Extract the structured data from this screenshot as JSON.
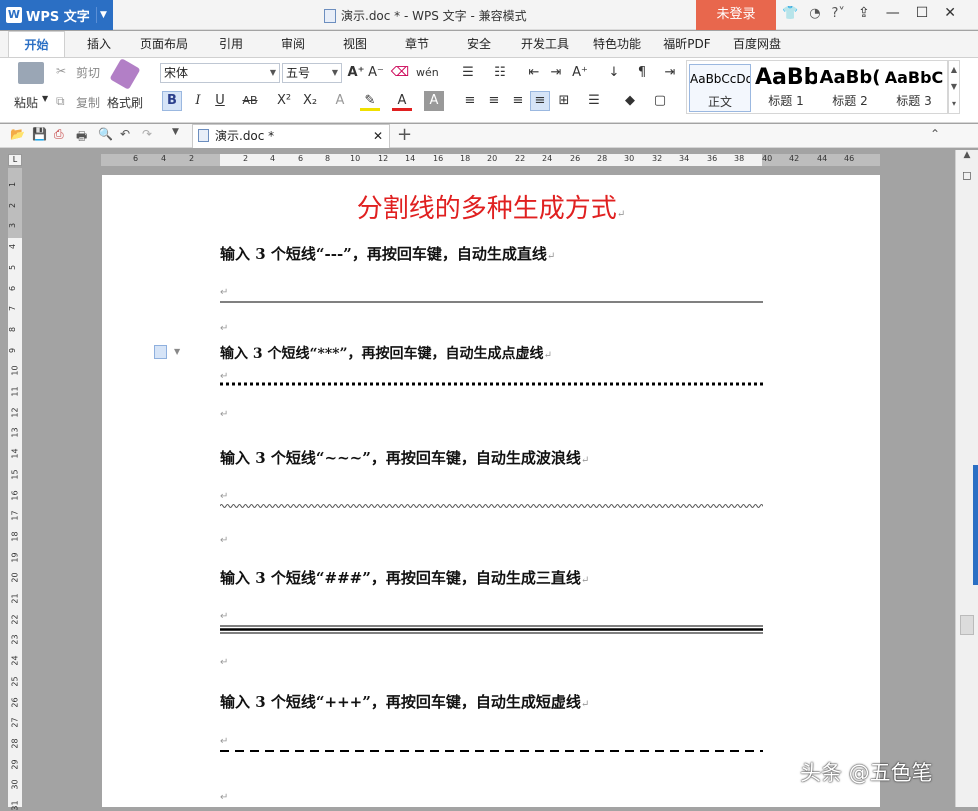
{
  "app": {
    "name": "WPS 文字",
    "logo_letter": "W"
  },
  "window": {
    "title": "演示.doc * - WPS 文字 - 兼容模式",
    "login_label": "未登录"
  },
  "menu_tabs": [
    "开始",
    "插入",
    "页面布局",
    "引用",
    "审阅",
    "视图",
    "章节",
    "安全",
    "开发工具",
    "特色功能",
    "福昕PDF",
    "百度网盘"
  ],
  "active_tab": "开始",
  "ribbon": {
    "paste": "粘贴",
    "cut": "剪切",
    "copy": "复制",
    "format_painter": "格式刷",
    "font_name": "宋体",
    "font_size": "五号"
  },
  "styles": [
    {
      "preview": "AaBbCcDd",
      "name": "正文"
    },
    {
      "preview": "AaBb",
      "name": "标题 1"
    },
    {
      "preview": "AaBb(",
      "name": "标题 2"
    },
    {
      "preview": "AaBbC",
      "name": "标题 3"
    }
  ],
  "doc_tab": {
    "name": "演示.doc *"
  },
  "ruler": {
    "h_ticks": [
      "6",
      "4",
      "2",
      "2",
      "4",
      "6",
      "8",
      "10",
      "12",
      "14",
      "16",
      "18",
      "20",
      "22",
      "24",
      "26",
      "28",
      "30",
      "32",
      "34",
      "36",
      "38",
      "40",
      "42",
      "44",
      "46"
    ],
    "v_ticks": [
      "1",
      "2",
      "3",
      "4",
      "5",
      "6",
      "7",
      "8",
      "9",
      "10",
      "11",
      "12",
      "13",
      "14",
      "15",
      "16",
      "17",
      "18",
      "19",
      "20",
      "21",
      "22",
      "23",
      "24",
      "25",
      "26",
      "27",
      "28",
      "29",
      "30",
      "31"
    ]
  },
  "document": {
    "heading": "分割线的多种生成方式",
    "para_mark": "↵",
    "items": [
      {
        "text": "输入 3 个短线“---”，再按回车键，自动生成直线"
      },
      {
        "text": "输入 3 个短线“***”，再按回车键，自动生成点虚线"
      },
      {
        "text": "输入 3 个短线“~~~”，再按回车键，自动生成波浪线"
      },
      {
        "text": "输入 3 个短线“###”，再按回车键，自动生成三直线"
      },
      {
        "text": "输入 3 个短线“+++”，再按回车键，自动生成短虚线"
      }
    ]
  },
  "watermark": "头条 @五色笔"
}
